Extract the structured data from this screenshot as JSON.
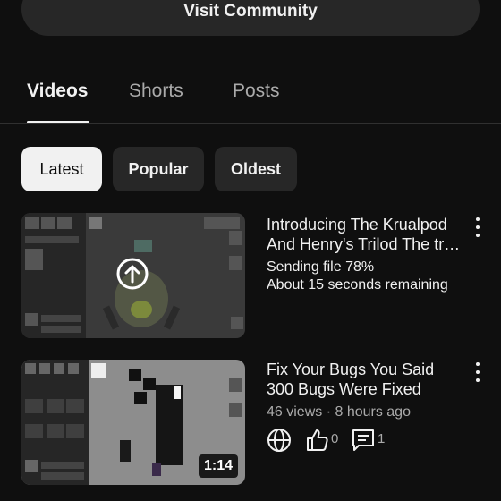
{
  "header": {
    "visit_community_label": "Visit Community"
  },
  "tabs": [
    {
      "label": "Videos",
      "active": true
    },
    {
      "label": "Shorts",
      "active": false
    },
    {
      "label": "Posts",
      "active": false
    }
  ],
  "filters": [
    {
      "label": "Latest",
      "selected": true
    },
    {
      "label": "Popular",
      "selected": false
    },
    {
      "label": "Oldest",
      "selected": false
    }
  ],
  "videos": [
    {
      "title": "Introducing The Krualpod And Henry's Trilod The tr…",
      "status_line1": "Sending file 78%",
      "status_line2": "About 15 seconds remaining",
      "upload_progress": 0.78,
      "thumb_icon": "upload-arrow-icon"
    },
    {
      "title": "Fix Your Bugs You Said 300 Bugs Were Fixed",
      "meta": "46 views · 8 hours ago",
      "duration": "1:14",
      "likes": "0",
      "comments": "1",
      "visibility_icon": "globe-icon"
    }
  ],
  "colors": {
    "background": "#0f0f0f",
    "surface": "#272727",
    "text": "#f1f1f1",
    "muted": "#aaaaaa"
  }
}
